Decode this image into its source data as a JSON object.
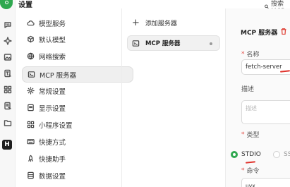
{
  "header": {
    "title": "设置",
    "search_label": "搜索 MCP"
  },
  "nav": {
    "items": [
      {
        "label": "模型服务",
        "icon": "cloud-icon"
      },
      {
        "label": "默认模型",
        "icon": "cube-icon"
      },
      {
        "label": "网络搜索",
        "icon": "globe-icon"
      },
      {
        "label": "MCP 服务器",
        "icon": "terminal-icon",
        "active": true
      },
      {
        "label": "常规设置",
        "icon": "gear-icon"
      },
      {
        "label": "显示设置",
        "icon": "monitor-icon"
      },
      {
        "label": "小程序设置",
        "icon": "grid-icon"
      },
      {
        "label": "快捷方式",
        "icon": "keyboard-icon"
      },
      {
        "label": "快捷助手",
        "icon": "rocket-icon"
      },
      {
        "label": "数据设置",
        "icon": "database-icon"
      }
    ]
  },
  "servers": {
    "add_label": "添加服务器",
    "items": [
      {
        "label": "MCP 服务器",
        "status": "inactive"
      }
    ]
  },
  "editor": {
    "title": "MCP 服务器",
    "name_label": "名称",
    "name_value": "fetch-server",
    "desc_label": "描述",
    "desc_placeholder": "描述",
    "type_label": "类型",
    "type_options": [
      {
        "label": "STDIO",
        "selected": true
      },
      {
        "label": "SS",
        "selected": false
      }
    ],
    "command_label": "命令",
    "command_value": "uvx"
  },
  "colors": {
    "accent": "#2fa84f",
    "required": "#e34a43",
    "annotation": "#e0322b",
    "delete": "#e0473c"
  }
}
